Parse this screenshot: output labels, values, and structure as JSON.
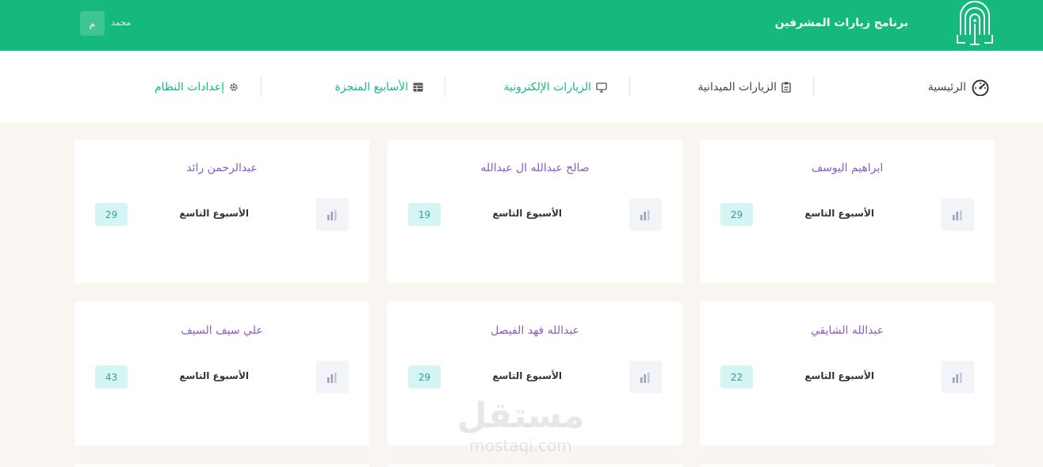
{
  "header": {
    "app_title": "برنامج زيارات المشرفين",
    "user_name": "محمد",
    "avatar_letter": "م",
    "brand_color": "#15b97c"
  },
  "nav": {
    "home": "الرئيسية",
    "field_visits": "الزيارات الميدانية",
    "e_visits": "الزيارات الإلكترونية",
    "completed_weeks": "الأسابيع المنجزة",
    "settings": "إعدادات النظام"
  },
  "cards": [
    {
      "name": "ابراهيم اليوسف",
      "week": "الأسبوع التاسع",
      "count": "29"
    },
    {
      "name": "صالح عبدالله ال عبدالله",
      "week": "الأسبوع التاسع",
      "count": "19"
    },
    {
      "name": "عبدالرحمن رائد",
      "week": "الأسبوع التاسع",
      "count": "29"
    },
    {
      "name": "عبدالله الشايقي",
      "week": "الأسبوع التاسع",
      "count": "22"
    },
    {
      "name": "عبدالله فهد الفيصل",
      "week": "الأسبوع التاسع",
      "count": "29"
    },
    {
      "name": "علي سيف السيف",
      "week": "الأسبوع التاسع",
      "count": "43"
    }
  ],
  "watermark": {
    "arabic": "مستقل",
    "latin": "mostaqi.com"
  }
}
